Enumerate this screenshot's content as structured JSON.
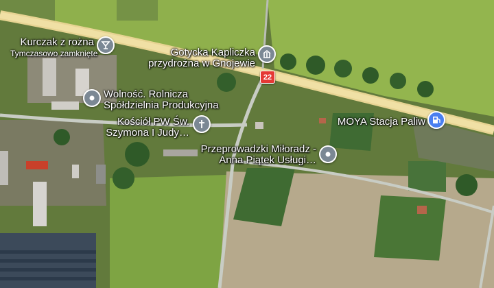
{
  "map": {
    "road_shield": "22",
    "pois": [
      {
        "name": "Kurczak z rożna",
        "status": "Tymczasowo zamknięte",
        "icon": "cocktail-icon",
        "color": "#7b8894"
      },
      {
        "name": "Gotycka Kapliczka przydrożna w Gnojewie",
        "icon": "monument-icon",
        "color": "#7b8894"
      },
      {
        "name": "Wolność. Rolnicza Spółdzielnia Produkcyjna",
        "icon": "place-icon",
        "color": "#7b8894"
      },
      {
        "name": "Kościół PW Św. Szymona I Judy…",
        "icon": "church-cross-icon",
        "color": "#7b8894"
      },
      {
        "name": "MOYA Stacja Paliw",
        "icon": "gas-station-icon",
        "color": "#4a7ff0"
      },
      {
        "name": "Przeprowadzki Miłoradz - Anna Piątek Usługi…",
        "icon": "place-icon",
        "color": "#7b8894"
      }
    ]
  }
}
